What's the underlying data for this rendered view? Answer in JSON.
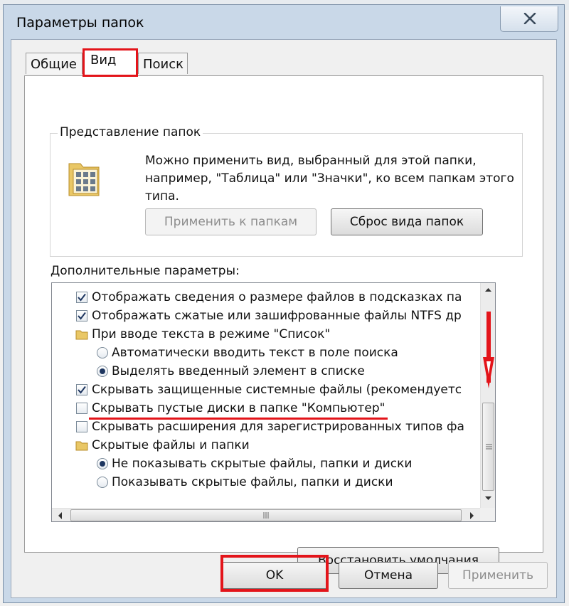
{
  "window": {
    "title": "Параметры папок",
    "close_icon": "close-icon"
  },
  "tabs": [
    {
      "label": "Общие",
      "active": false
    },
    {
      "label": "Вид",
      "active": true
    },
    {
      "label": "Поиск",
      "active": false
    }
  ],
  "folder_views": {
    "group_title": "Представление папок",
    "icon": "folder-view-icon",
    "description": "Можно применить вид, выбранный для этой папки, например, \"Таблица\" или \"Значки\", ко всем папкам этого типа.",
    "apply_button": "Применить к папкам",
    "reset_button": "Сброс вида папок"
  },
  "advanced": {
    "label": "Дополнительные параметры:",
    "items": [
      {
        "type": "checkbox",
        "checked": true,
        "label": "Отображать сведения о размере файлов в подсказках па"
      },
      {
        "type": "checkbox",
        "checked": true,
        "label": "Отображать сжатые или зашифрованные файлы NTFS др"
      },
      {
        "type": "folder",
        "label": "При вводе текста в режиме \"Список\""
      },
      {
        "type": "radio",
        "checked": false,
        "label": "Автоматически вводить текст в поле поиска"
      },
      {
        "type": "radio",
        "checked": true,
        "label": "Выделять введенный элемент в списке"
      },
      {
        "type": "checkbox",
        "checked": true,
        "label": "Скрывать защищенные системные файлы (рекомендуетс"
      },
      {
        "type": "checkbox",
        "checked": false,
        "label": "Скрывать пустые диски в папке \"Компьютер\""
      },
      {
        "type": "checkbox",
        "checked": false,
        "label": "Скрывать расширения для зарегистрированных типов фа"
      },
      {
        "type": "folder",
        "label": "Скрытые файлы и папки"
      },
      {
        "type": "radio",
        "checked": true,
        "label": "Не показывать скрытые файлы, папки и диски"
      },
      {
        "type": "radio",
        "checked": false,
        "label": "Показывать скрытые файлы, папки и диски"
      }
    ],
    "restore_button": "Восстановить умолчания"
  },
  "footer": {
    "ok_button": "OK",
    "cancel_button": "Отмена",
    "apply_button": "Применить"
  },
  "colors": {
    "highlight_red": "#e3141a",
    "window_frame": "#c9d8e8"
  }
}
